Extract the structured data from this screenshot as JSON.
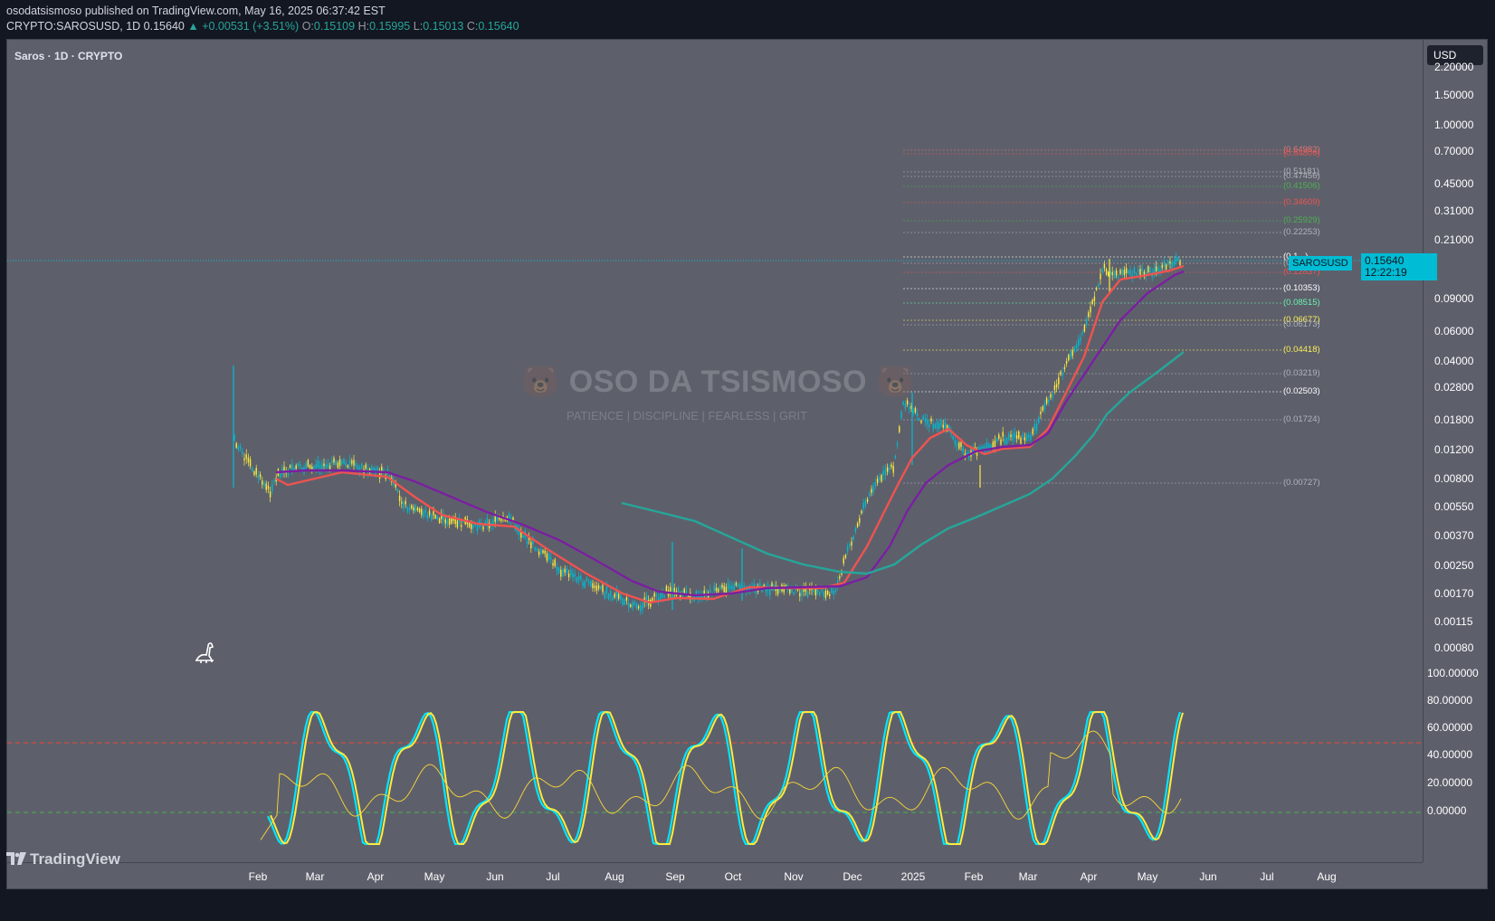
{
  "header": {
    "publisher_line": "osodatsismoso published on TradingView.com, May 16, 2025 06:37:42 EST",
    "symbol": "CRYPTO:SAROSUSD, 1D",
    "last": "0.15640",
    "change": "▲ +0.00531 (+3.51%)",
    "o_label": "O:",
    "o_val": "0.15109",
    "h_label": "H:",
    "h_val": "0.15995",
    "l_label": "L:",
    "l_val": "0.15013",
    "c_label": "C:",
    "c_val": "0.15640"
  },
  "legend": {
    "title": "Saros · 1D · CRYPTO"
  },
  "currency": "USD",
  "last_tag": {
    "symbol": "SAROSUSD",
    "price": "0.15640",
    "countdown": "12:22:19"
  },
  "watermark": {
    "title": "🐻 OSO DA TSISMOSO 🐻",
    "subtitle": "PATIENCE   |   DISCIPLINE   |  FEARLESS  |   GRIT"
  },
  "price_axis": [
    "2.20000",
    "1.50000",
    "1.00000",
    "0.70000",
    "0.45000",
    "0.31000",
    "0.21000",
    "0.09000",
    "0.06000",
    "0.04000",
    "0.02800",
    "0.01800",
    "0.01200",
    "0.00800",
    "0.00550",
    "0.00370",
    "0.00250",
    "0.00170",
    "0.00115",
    "0.00080"
  ],
  "osc_axis": [
    "100.00000",
    "80.00000",
    "60.00000",
    "40.00000",
    "20.00000",
    "0.00000"
  ],
  "time_axis": [
    "Feb",
    "Mar",
    "Apr",
    "May",
    "Jun",
    "Jul",
    "Aug",
    "Sep",
    "Oct",
    "Nov",
    "Dec",
    "2025",
    "Feb",
    "Mar",
    "Apr",
    "May",
    "Jun",
    "Jul",
    "Aug"
  ],
  "fib_levels": [
    {
      "label": "(0.64982)",
      "color": "#e57373"
    },
    {
      "label": "(0.64806)",
      "color": "#ef5350"
    },
    {
      "label": "(0.51181)",
      "color": "#b0b3bb"
    },
    {
      "label": "(0.47456)",
      "color": "#b0b3bb"
    },
    {
      "label": "(0.41506)",
      "color": "#4caf50"
    },
    {
      "label": "(0.34609)",
      "color": "#ef5350"
    },
    {
      "label": "(0.25929)",
      "color": "#4caf50"
    },
    {
      "label": "(0.22253)",
      "color": "#b0b3bb"
    },
    {
      "label": "(0.1...)",
      "color": "#ffffff"
    },
    {
      "label": "(0.1...)",
      "color": "#b0b3bb"
    },
    {
      "label": "(0.12837)",
      "color": "#ef5350"
    },
    {
      "label": "(0.10353)",
      "color": "#ffffff"
    },
    {
      "label": "(0.08515)",
      "color": "#69f0ae"
    },
    {
      "label": "(0.06677)",
      "color": "#ffee58"
    },
    {
      "label": "(0.06173)",
      "color": "#b0b3bb"
    },
    {
      "label": "(0.04418)",
      "color": "#ffee58"
    },
    {
      "label": "(0.03219)",
      "color": "#b0b3bb"
    },
    {
      "label": "(0.02503)",
      "color": "#ffffff"
    },
    {
      "label": "(0.01724)",
      "color": "#b0b3bb"
    },
    {
      "label": "(0.00727)",
      "color": "#b0b3bb"
    }
  ],
  "colors": {
    "background": "#5d606b",
    "up": "#00bcd4",
    "down": "#ffeb3b",
    "ema_fast": "#ef5350",
    "ema_mid": "#7b1fa2",
    "ema_slow": "#26a69a",
    "osc_k": "#00e5ff",
    "osc_d": "#ffeb3b",
    "osc_rsi": "#fdd835",
    "overbought": "#f44336",
    "oversold": "#4caf50"
  },
  "footer": {
    "brand": "TradingView"
  }
}
